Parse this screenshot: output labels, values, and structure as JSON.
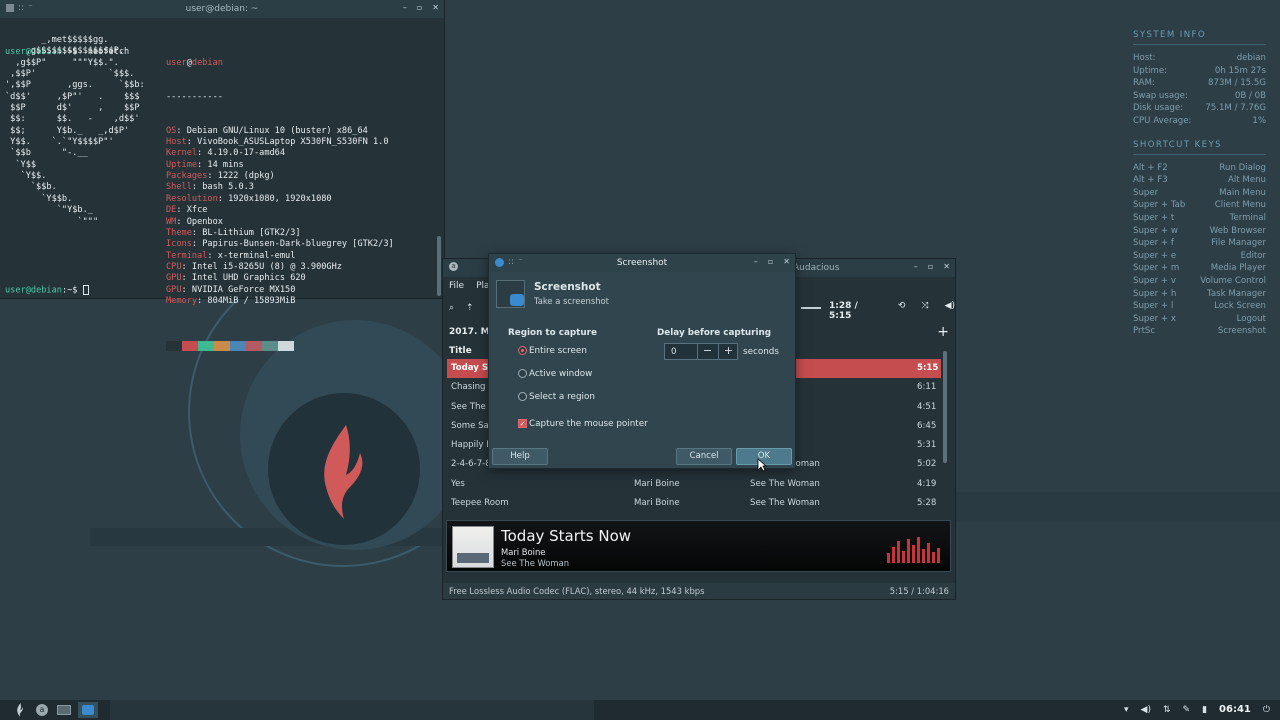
{
  "terminal": {
    "title": "user@debian: ~",
    "prompt_user": "user",
    "prompt_host": "debian",
    "prompt_suffix": ":~$",
    "command": "neofetch",
    "ascii": [
      "       _,met$$$$$gg.",
      "    ,g$$$$$$$$$$$$$$$P.",
      "  ,g$$P\"     \"\"\"Y$$.\".",
      " ,$$P'              `$$$.",
      "',$$P       ,ggs.     `$$b:",
      "`d$$'     ,$P\"'   .    $$$",
      " $$P      d$'     ,    $$P",
      " $$:      $$.   -    ,d$$'",
      " $$;      Y$b._   _,d$P'",
      " Y$$.    `.`\"Y$$$$P\"'",
      " `$$b      \"-.__",
      "  `Y$$",
      "   `Y$$.",
      "     `$$b.",
      "       `Y$$b.",
      "          `\"Y$b._",
      "              `\"\"\""
    ],
    "userhost": {
      "user": "user",
      "at": "@",
      "host": "debian"
    },
    "separator": "-----------",
    "info": [
      {
        "key": "OS",
        "value": "Debian GNU/Linux 10 (buster) x86_64"
      },
      {
        "key": "Host",
        "value": "VivoBook_ASUSLaptop X530FN_S530FN 1.0"
      },
      {
        "key": "Kernel",
        "value": "4.19.0-17-amd64"
      },
      {
        "key": "Uptime",
        "value": "14 mins"
      },
      {
        "key": "Packages",
        "value": "1222 (dpkg)"
      },
      {
        "key": "Shell",
        "value": "bash 5.0.3"
      },
      {
        "key": "Resolution",
        "value": "1920x1080, 1920x1080"
      },
      {
        "key": "DE",
        "value": "Xfce"
      },
      {
        "key": "WM",
        "value": "Openbox"
      },
      {
        "key": "Theme",
        "value": "BL-Lithium [GTK2/3]"
      },
      {
        "key": "Icons",
        "value": "Papirus-Bunsen-Dark-bluegrey [GTK2/3]"
      },
      {
        "key": "Terminal",
        "value": "x-terminal-emul"
      },
      {
        "key": "CPU",
        "value": "Intel i5-8265U (8) @ 3.900GHz"
      },
      {
        "key": "GPU",
        "value": "Intel UHD Graphics 620"
      },
      {
        "key": "GPU",
        "value": "NVIDIA GeForce MX150"
      },
      {
        "key": "Memory",
        "value": "804MiB / 15893MiB"
      }
    ],
    "palette": [
      "#253339",
      "#c64d4f",
      "#3fb991",
      "#c98a4a",
      "#4a86b6",
      "#b45a62",
      "#5b8e8a",
      "#cfd8dc"
    ]
  },
  "conky": {
    "system_title": "SYSTEM INFO",
    "system": [
      {
        "k": "Host:",
        "v": "debian"
      },
      {
        "k": "Uptime:",
        "v": "0h 15m 27s"
      },
      {
        "k": "RAM:",
        "v": "873M / 15.5G"
      },
      {
        "k": "Swap usage:",
        "v": "0B / 0B"
      },
      {
        "k": "Disk usage:",
        "v": "75.1M / 7.76G"
      },
      {
        "k": "CPU Average:",
        "v": "1%"
      }
    ],
    "keys_title": "SHORTCUT KEYS",
    "keys": [
      {
        "k": "Alt + F2",
        "v": "Run Dialog"
      },
      {
        "k": "Alt + F3",
        "v": "Alt Menu"
      },
      {
        "k": "Super",
        "v": "Main Menu"
      },
      {
        "k": "Super + Tab",
        "v": "Client Menu"
      },
      {
        "k": "Super + t",
        "v": "Terminal"
      },
      {
        "k": "Super + w",
        "v": "Web Browser"
      },
      {
        "k": "Super + f",
        "v": "File Manager"
      },
      {
        "k": "Super + e",
        "v": "Editor"
      },
      {
        "k": "Super + m",
        "v": "Media Player"
      },
      {
        "k": "Super + v",
        "v": "Volume Control"
      },
      {
        "k": "Super + h",
        "v": "Task Manager"
      },
      {
        "k": "Super + l",
        "v": "Lock Screen"
      },
      {
        "k": "Super + x",
        "v": "Logout"
      },
      {
        "k": "PrtSc",
        "v": "Screenshot"
      }
    ]
  },
  "audacious": {
    "title": "Audacious",
    "menu": [
      "File",
      "Play"
    ],
    "time": "1:28 / 5:15",
    "playlist_tab": "2017. Ma",
    "col_title": "Title",
    "rows": [
      {
        "title": "Today St",
        "artist": "",
        "album": "oman",
        "len": "5:15",
        "selected": true
      },
      {
        "title": "Chasing I",
        "artist": "",
        "album": "oman",
        "len": "6:11"
      },
      {
        "title": "See The V",
        "artist": "",
        "album": "oman",
        "len": "4:51"
      },
      {
        "title": "Some Sa",
        "artist": "",
        "album": "oman",
        "len": "6:45"
      },
      {
        "title": "Happily E",
        "artist": "",
        "album": "oman",
        "len": "5:31"
      },
      {
        "title": "2-4-6-7-8-9 In One",
        "artist": "Mari Boine",
        "album": "See The Woman",
        "len": "5:02"
      },
      {
        "title": "Yes",
        "artist": "Mari Boine",
        "album": "See The Woman",
        "len": "4:19"
      },
      {
        "title": "Teepee Room",
        "artist": "Mari Boine",
        "album": "See The Woman",
        "len": "5:28"
      }
    ],
    "now_title": "Today Starts Now",
    "now_artist": "Mari Boine",
    "now_album": "See The Woman",
    "status_codec": "Free Lossless Audio Codec (FLAC), stereo, 44 kHz, 1543 kbps",
    "status_time": "5:15 / 1:04:16",
    "visualizer": [
      10,
      16,
      22,
      12,
      24,
      18,
      26,
      14,
      20,
      11,
      15
    ]
  },
  "screenshot": {
    "window_title": "Screenshot",
    "heading": "Screenshot",
    "subheading": "Take a screenshot",
    "region_label": "Region to capture",
    "options": [
      "Entire screen",
      "Active window",
      "Select a region"
    ],
    "selected_option": 0,
    "pointer_label": "Capture the mouse pointer",
    "pointer_checked": true,
    "delay_label": "Delay before capturing",
    "delay_value": "0",
    "delay_unit": "seconds",
    "help": "Help",
    "cancel": "Cancel",
    "ok": "OK"
  },
  "taskbar": {
    "clock": "06:41"
  }
}
